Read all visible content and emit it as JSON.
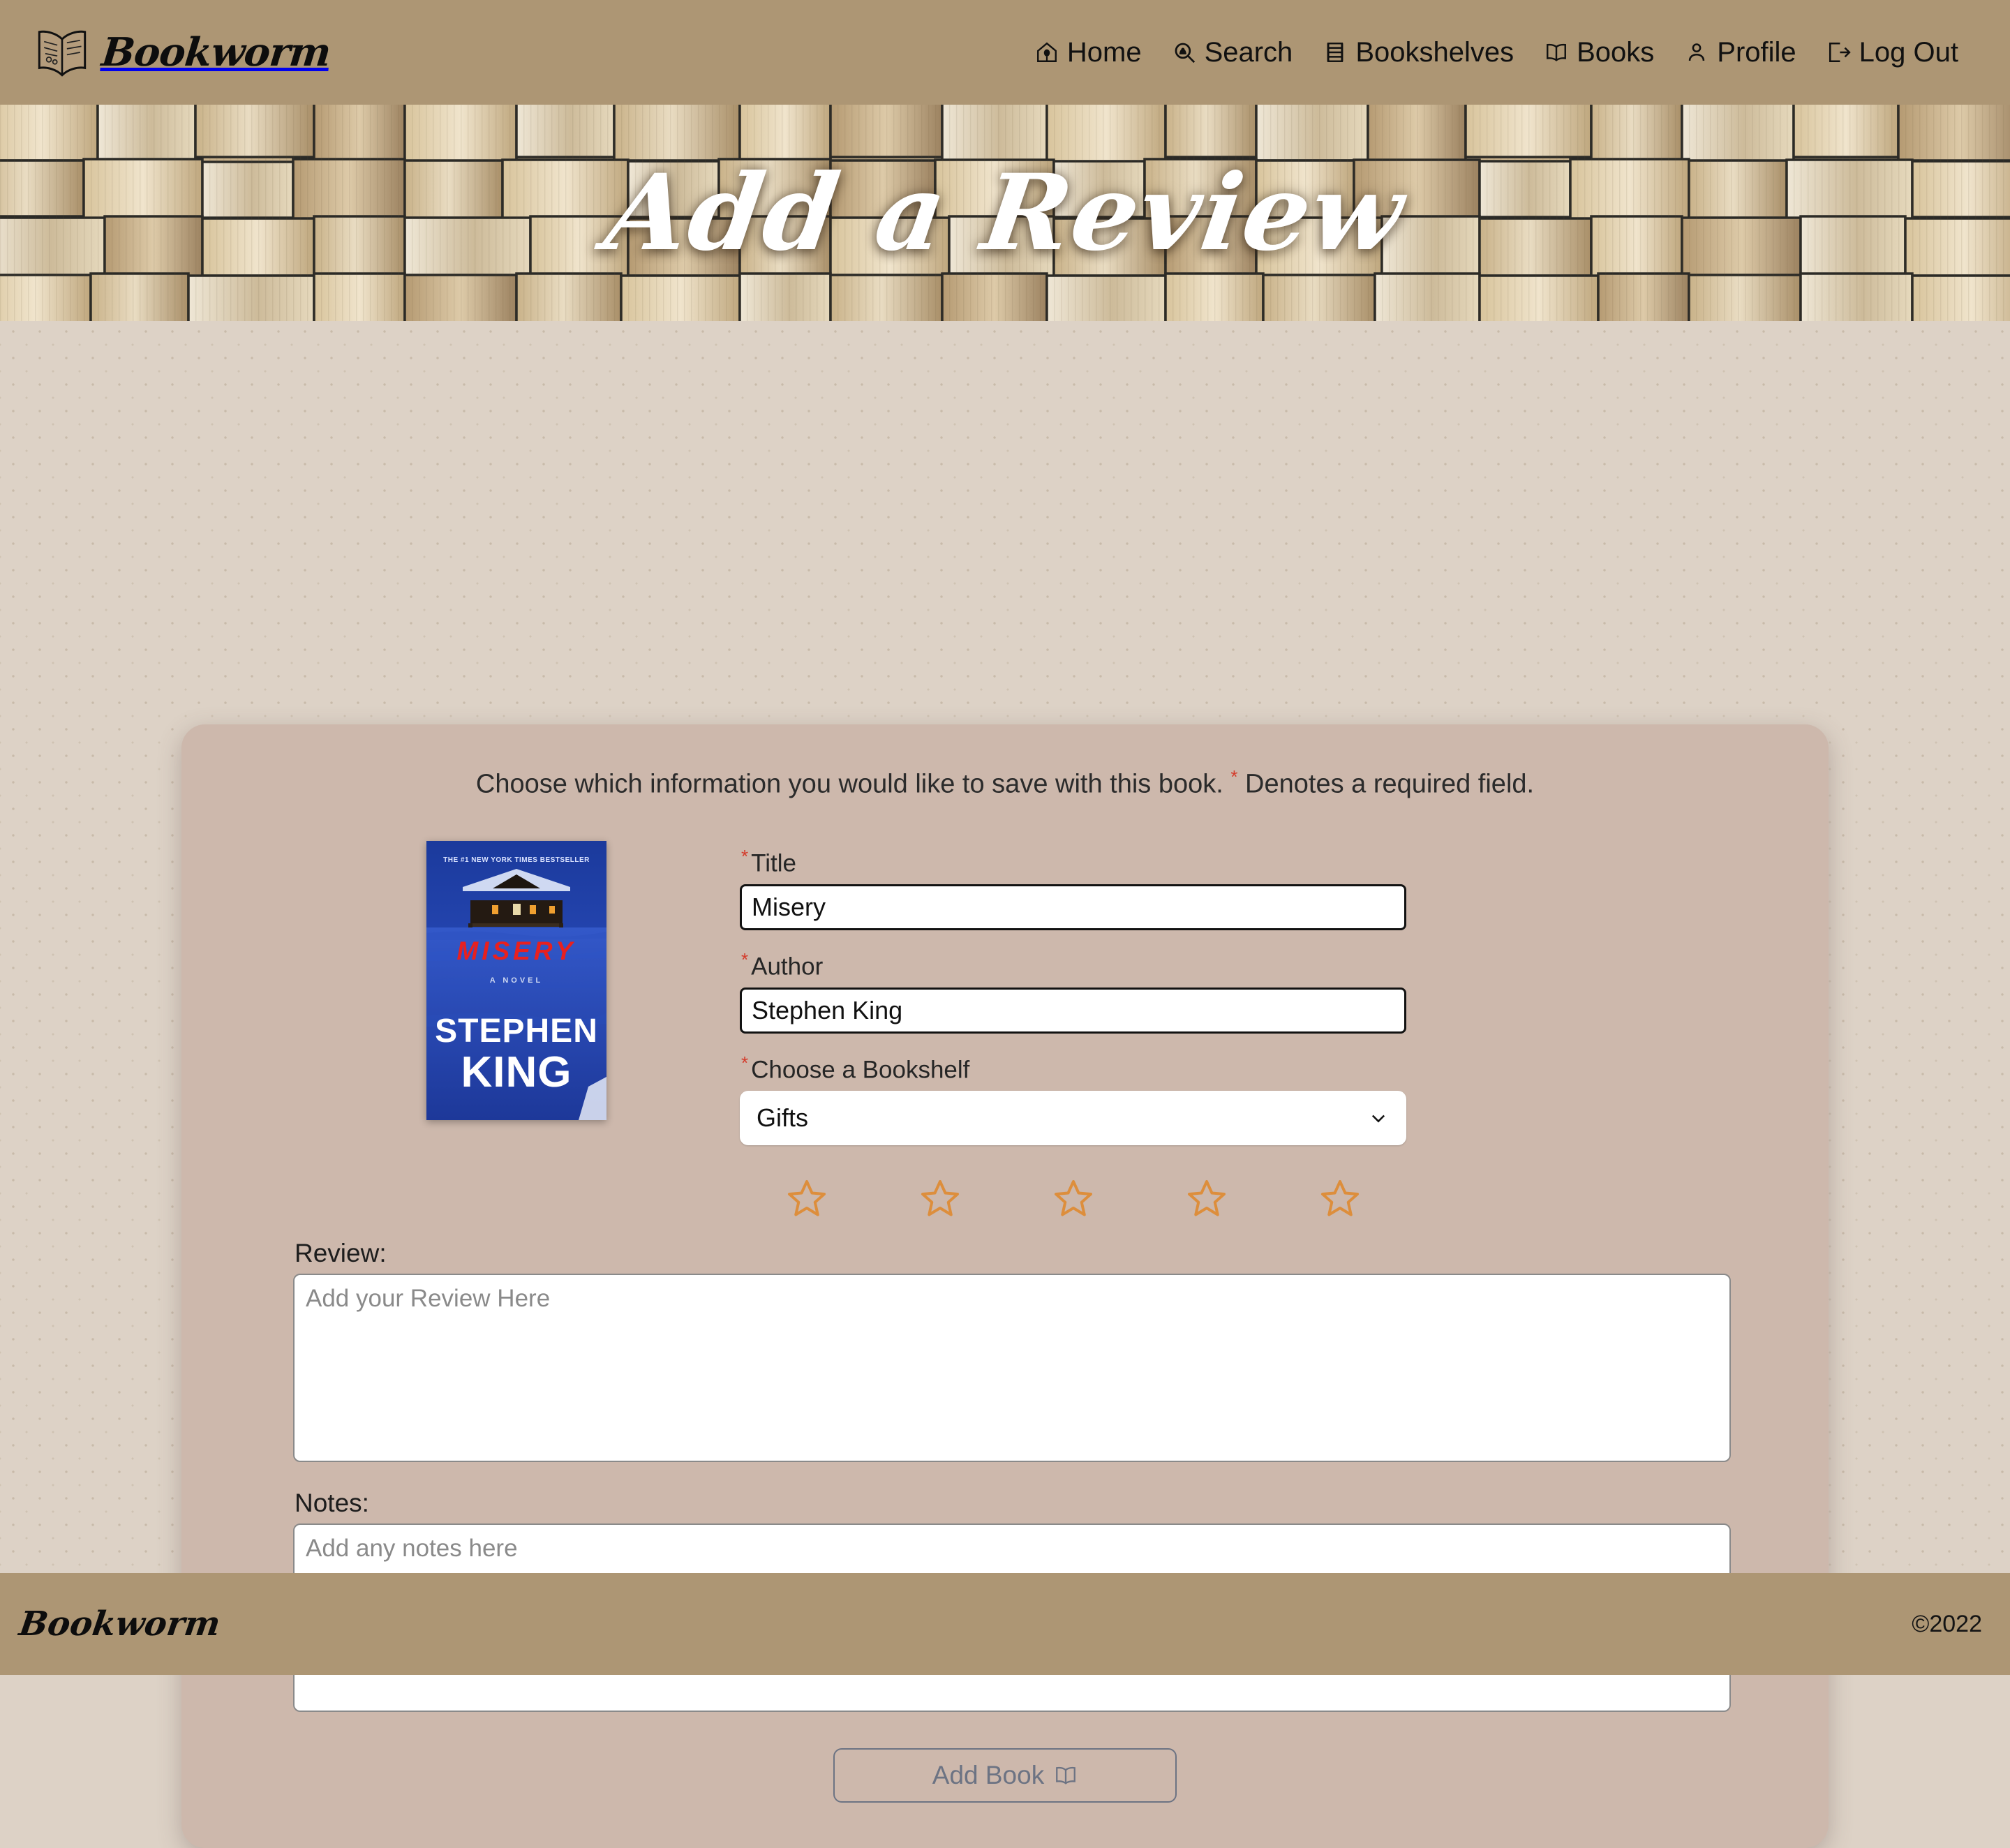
{
  "brand": {
    "name": "Bookworm",
    "logo_icon": "open-book-icon"
  },
  "nav": {
    "items": [
      {
        "label": "Home",
        "icon": "home-icon"
      },
      {
        "label": "Search",
        "icon": "search-icon"
      },
      {
        "label": "Bookshelves",
        "icon": "bookshelf-icon"
      },
      {
        "label": "Books",
        "icon": "book-open-icon"
      },
      {
        "label": "Profile",
        "icon": "person-icon"
      },
      {
        "label": "Log Out",
        "icon": "logout-icon"
      }
    ]
  },
  "hero": {
    "title": "Add a Review"
  },
  "form": {
    "instructions_before": "Choose which information you would like to save with this book.",
    "required_marker": "*",
    "instructions_after": "Denotes a required field.",
    "title_label": "Title",
    "title_value": "Misery",
    "author_label": "Author",
    "author_value": "Stephen King",
    "bookshelf_label": "Choose a Bookshelf",
    "bookshelf_value": "Gifts",
    "bookshelf_options": [
      "Gifts"
    ],
    "rating_stars": 5,
    "rating_selected": 0,
    "review_label": "Review:",
    "review_value": "",
    "review_placeholder": "Add your Review Here",
    "notes_label": "Notes:",
    "notes_value": "",
    "notes_placeholder": "Add any notes here",
    "submit_label": "Add Book",
    "submit_icon": "book-open-icon"
  },
  "cover": {
    "alt": "Misery book cover",
    "bestseller_line": "THE #1 NEW YORK TIMES BESTSELLER",
    "title": "MISERY",
    "subtitle": "A NOVEL",
    "author_first": "STEPHEN",
    "author_last": "KING"
  },
  "footer": {
    "brand": "Bookworm",
    "copyright": "©2022"
  },
  "colors": {
    "header_bar": "#ad9674",
    "page_background": "#ddd2c6",
    "card_background": "#cdb8ac",
    "star_outline": "#dd8e3c",
    "required_red": "#d43a2a",
    "button_muted": "#6c7383",
    "cover_blue": "#2340a8"
  }
}
